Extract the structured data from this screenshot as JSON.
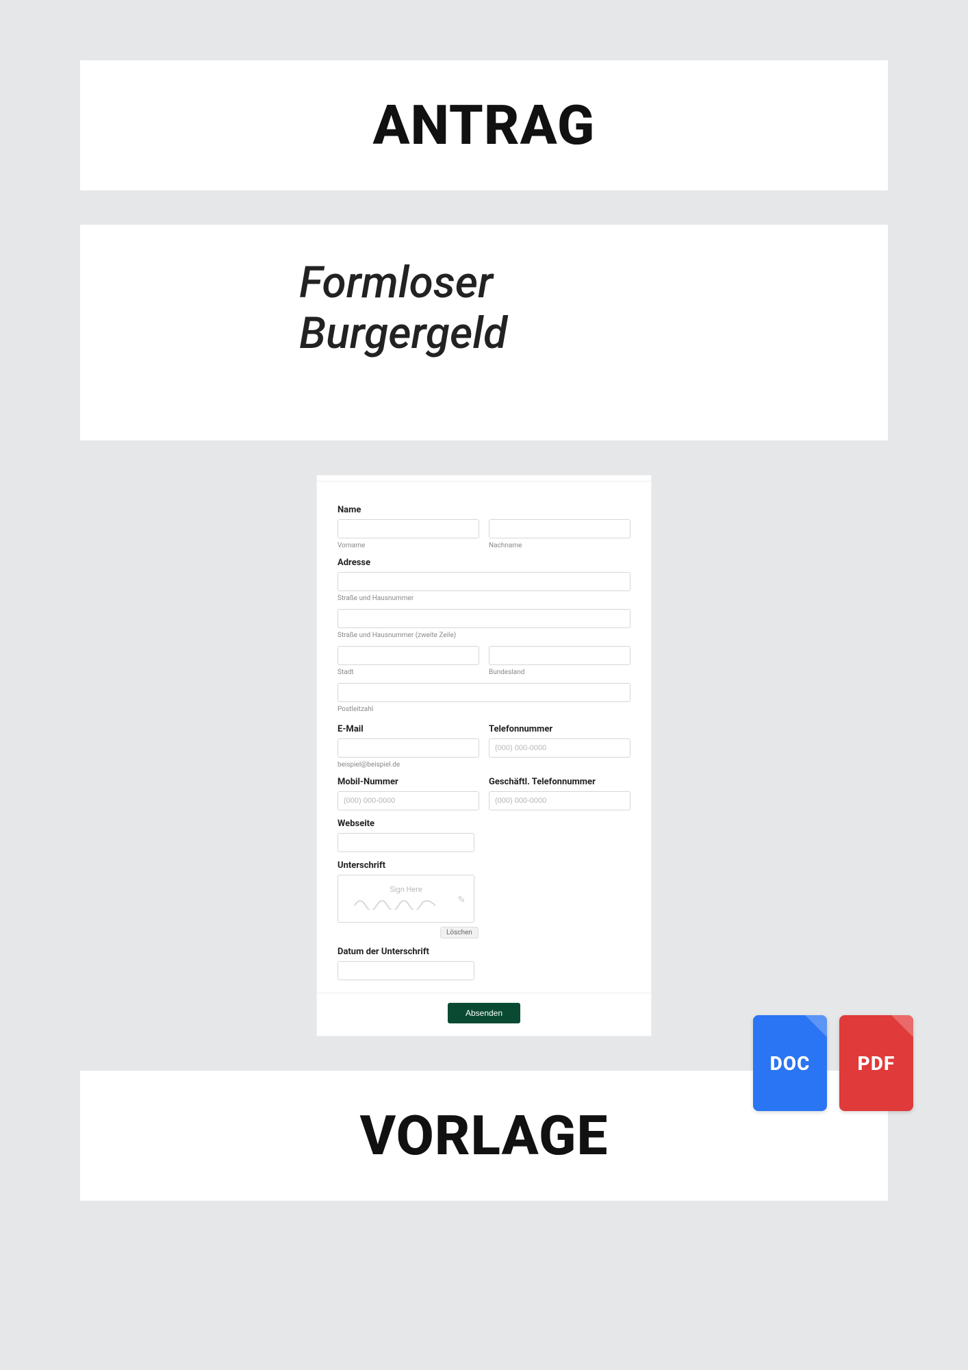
{
  "header": {
    "title": "ANTRAG"
  },
  "subtitle": {
    "line1": "Formloser",
    "line2": "Burgergeld"
  },
  "form": {
    "name": {
      "label": "Name",
      "first_sub": "Vorname",
      "last_sub": "Nachname"
    },
    "address": {
      "label": "Adresse",
      "street_sub": "Straße und Hausnummer",
      "street2_sub": "Straße und Hausnummer (zweite Zeile)",
      "city_sub": "Stadt",
      "state_sub": "Bundesland",
      "zip_sub": "Postleitzahl"
    },
    "email": {
      "label": "E-Mail",
      "sub": "beispiel@beispiel.de"
    },
    "phone": {
      "label": "Telefonnummer",
      "placeholder": "(000) 000-0000"
    },
    "mobile": {
      "label": "Mobil-Nummer",
      "placeholder": "(000) 000-0000"
    },
    "bizphone": {
      "label": "Geschäftl. Telefonnummer",
      "placeholder": "(000) 000-0000"
    },
    "website": {
      "label": "Webseite"
    },
    "signature": {
      "label": "Unterschrift",
      "sign_here": "Sign Here",
      "clear": "Löschen"
    },
    "sigdate": {
      "label": "Datum der Unterschrift"
    },
    "submit": "Absenden"
  },
  "files": {
    "doc": "DOC",
    "pdf": "PDF"
  },
  "footer": {
    "title": "VORLAGE"
  }
}
